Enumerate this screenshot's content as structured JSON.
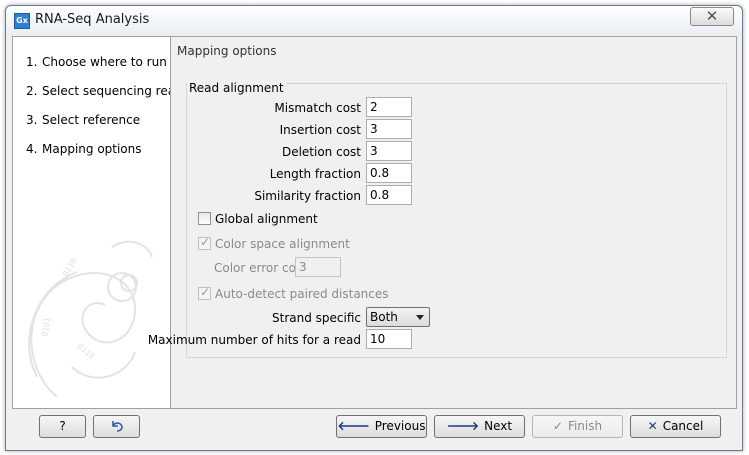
{
  "window": {
    "title": "RNA-Seq Analysis",
    "app_icon_text": "Gx",
    "close_glyph": "✕"
  },
  "steps": [
    {
      "num": "1.",
      "label": "Choose where to run"
    },
    {
      "num": "2.",
      "label": "Select sequencing reads"
    },
    {
      "num": "3.",
      "label": "Select reference"
    },
    {
      "num": "4.",
      "label": "Mapping options"
    }
  ],
  "panel": {
    "title": "Mapping options",
    "group_title": "Read alignment",
    "mismatch_cost": {
      "label": "Mismatch cost",
      "value": "2"
    },
    "insertion_cost": {
      "label": "Insertion cost",
      "value": "3"
    },
    "deletion_cost": {
      "label": "Deletion cost",
      "value": "3"
    },
    "length_fraction": {
      "label": "Length fraction",
      "value": "0.8"
    },
    "similarity_fraction": {
      "label": "Similarity fraction",
      "value": "0.8"
    },
    "global_alignment": {
      "label": "Global alignment",
      "checked": false
    },
    "color_space_alignment": {
      "label": "Color space alignment",
      "checked": true,
      "enabled": false
    },
    "color_error_cost": {
      "label": "Color error cost",
      "value": "3"
    },
    "auto_detect_paired": {
      "label": "Auto-detect paired distances",
      "checked": true,
      "enabled": false
    },
    "strand_specific": {
      "label": "Strand specific",
      "value": "Both"
    },
    "max_hits": {
      "label": "Maximum number of hits for a read",
      "value": "10"
    }
  },
  "buttons": {
    "help": "?",
    "reset_icon": "undo-arrow-icon",
    "previous": "Previous",
    "next": "Next",
    "finish": "Finish",
    "cancel": "Cancel",
    "previous_glyph": "🡐",
    "next_glyph": "🡒",
    "finish_glyph": "✓",
    "cancel_glyph": "✕"
  },
  "colors": {
    "accent": "#2d7fcf",
    "disabled_text": "#8a8a8a"
  }
}
